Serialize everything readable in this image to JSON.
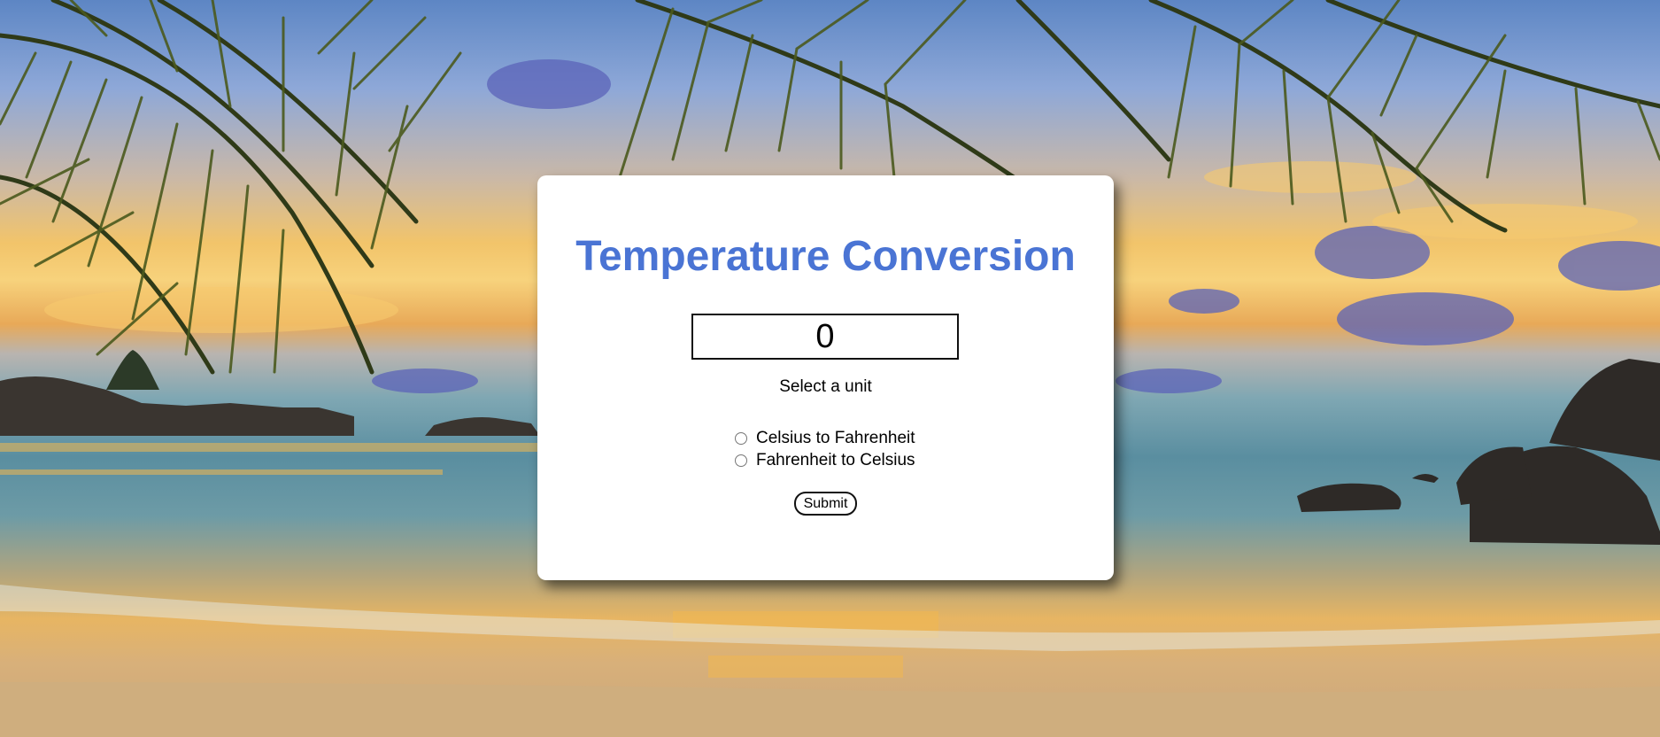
{
  "app": {
    "title": "Temperature Conversion"
  },
  "form": {
    "input_value": "0",
    "unit_prompt": "Select a unit",
    "options": [
      {
        "label": "Celsius to Fahrenheit",
        "checked": false
      },
      {
        "label": "Fahrenheit to Celsius",
        "checked": false
      }
    ],
    "submit_label": "Submit"
  },
  "colors": {
    "title": "#4a74d4",
    "card_background": "#ffffff"
  }
}
